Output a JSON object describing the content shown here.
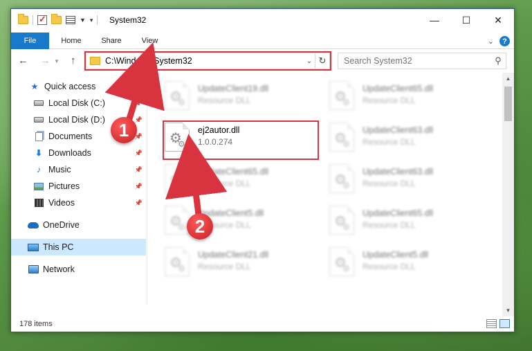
{
  "window": {
    "title": "System32",
    "controls": {
      "minimize": "—",
      "maximize": "☐",
      "close": "✕"
    }
  },
  "ribbon": {
    "tabs": [
      "File",
      "Home",
      "Share",
      "View"
    ],
    "help": "?"
  },
  "address_bar": {
    "path": "C:\\Windows\\System32"
  },
  "search": {
    "placeholder": "Search System32"
  },
  "sidebar": {
    "items": [
      {
        "label": "Quick access",
        "icon": "quick-access-star-icon"
      },
      {
        "label": "Local Disk (C:)",
        "icon": "drive-icon",
        "pinned": true
      },
      {
        "label": "Local Disk (D:)",
        "icon": "drive-icon",
        "pinned": true
      },
      {
        "label": "Documents",
        "icon": "documents-icon",
        "pinned": true
      },
      {
        "label": "Downloads",
        "icon": "downloads-icon",
        "pinned": true
      },
      {
        "label": "Music",
        "icon": "music-icon",
        "pinned": true
      },
      {
        "label": "Pictures",
        "icon": "pictures-icon",
        "pinned": true
      },
      {
        "label": "Videos",
        "icon": "videos-icon",
        "pinned": true
      },
      {
        "label": "OneDrive",
        "icon": "onedrive-icon"
      },
      {
        "label": "This PC",
        "icon": "this-pc-icon",
        "selected": true
      },
      {
        "label": "Network",
        "icon": "network-icon"
      }
    ]
  },
  "files": [
    {
      "name": "UpdateClient19.dll",
      "desc": "Resource DLL"
    },
    {
      "name": "UpdateClient65.dll",
      "desc": "Resource DLL"
    },
    {
      "name": "ej2autor.dll",
      "desc": "1.0.0.274",
      "highlighted": true
    },
    {
      "name": "UpdateClient63.dll",
      "desc": "Resource DLL"
    },
    {
      "name": "UpdateClient65.dll",
      "desc": "Resource DLL"
    },
    {
      "name": "UpdateClient63.dll",
      "desc": "Resource DLL"
    },
    {
      "name": "UpdateClient5.dll",
      "desc": "Resource DLL"
    },
    {
      "name": "UpdateClient65.dll",
      "desc": "Resource DLL"
    },
    {
      "name": "UpdateClient21.dll",
      "desc": "Resource DLL"
    },
    {
      "name": "UpdateClient5.dll",
      "desc": "Resource DLL"
    }
  ],
  "status": {
    "item_count": "178 items"
  },
  "annotations": {
    "step1": "1",
    "step2": "2",
    "color": "#d9333f"
  }
}
